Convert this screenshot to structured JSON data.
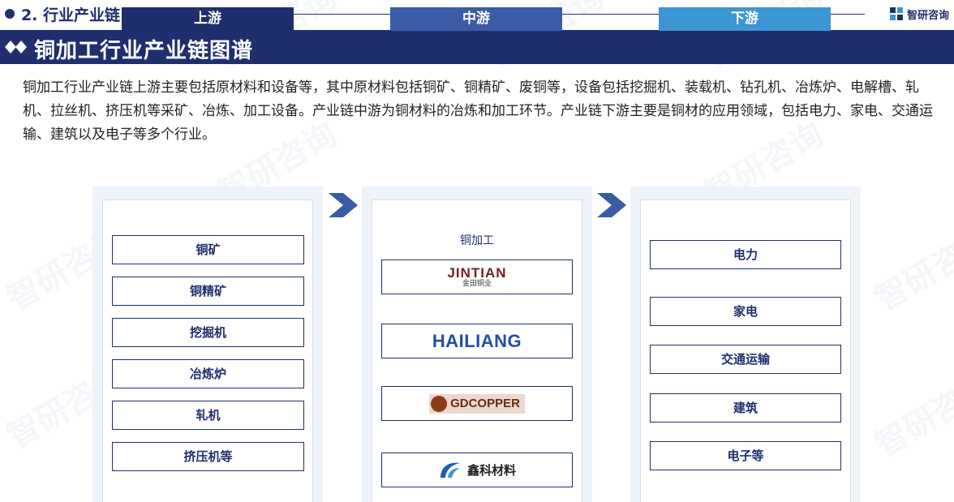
{
  "header": {
    "section_title": "2. 行业产业链",
    "brand_name": "智研咨询"
  },
  "title": "铜加工行业产业链图谱",
  "intro": "铜加工行业产业链上游主要包括原材料和设备等，其中原材料包括铜矿、铜精矿、废铜等，设备包括挖掘机、装载机、钻孔机、冶炼炉、电解槽、轧机、拉丝机、挤压机等采矿、冶炼、加工设备。产业链中游为铜材料的冶炼和加工环节。产业链下游主要是铜材的应用领域，包括电力、家电、交通运输、建筑以及电子等多个行业。",
  "upstream": {
    "label": "上游",
    "items": [
      "铜矿",
      "铜精矿",
      "挖掘机",
      "冶炼炉",
      "轧机",
      "挤压机等"
    ]
  },
  "midstream": {
    "label": "中游",
    "sub_label": "铜加工",
    "logos": [
      {
        "en": "JINTIAN",
        "cn": "金田铜业"
      },
      {
        "en": "HAILIANG"
      },
      {
        "en": "GDCOPPER"
      },
      {
        "cn": "鑫科材料"
      }
    ]
  },
  "downstream": {
    "label": "下游",
    "items": [
      "电力",
      "家电",
      "交通运输",
      "建筑",
      "电子等"
    ]
  },
  "colors": {
    "navy": "#1f2f6e",
    "upstream_head": "#1f2f6e",
    "midstream_head": "#3a5ba8",
    "downstream_head": "#3d95d3",
    "arrow": "#3a5ba8"
  },
  "watermark": "智研咨询"
}
